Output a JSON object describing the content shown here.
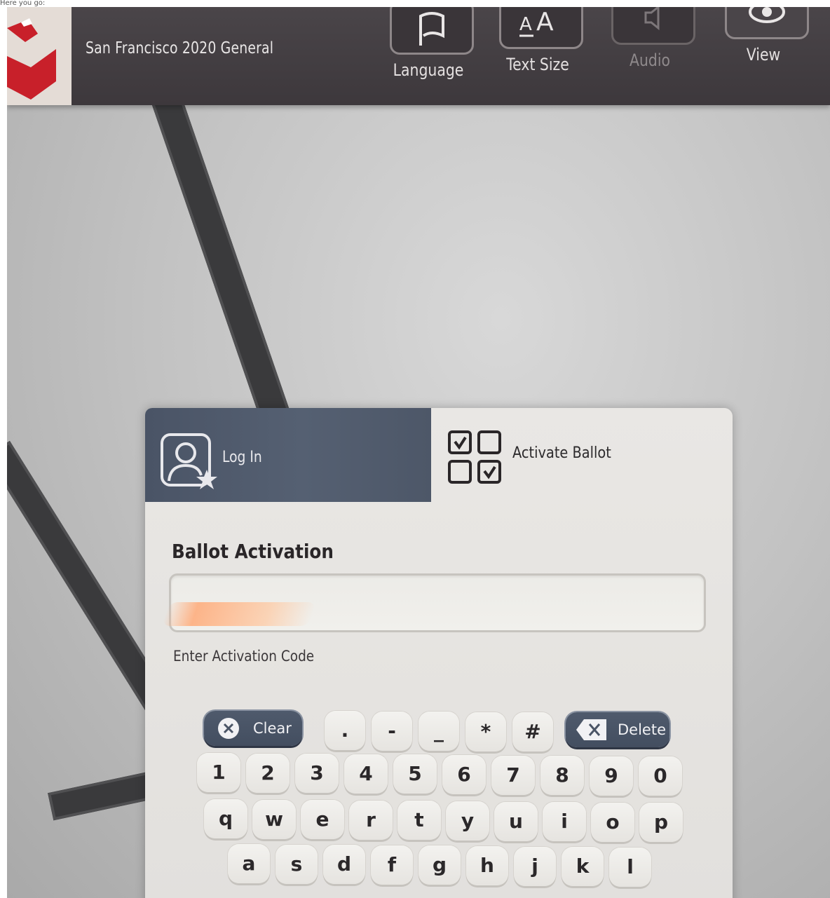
{
  "caption": "Here you go:",
  "header": {
    "election_title": "San Francisco 2020 General",
    "tools": [
      {
        "label": "Language",
        "icon": "flag-icon"
      },
      {
        "label": "Text Size",
        "icon": "text-size-icon"
      },
      {
        "label": "Audio",
        "icon": "audio-icon",
        "state": "disabled"
      },
      {
        "label": "View",
        "icon": "eye-icon"
      }
    ]
  },
  "tabs": {
    "login": {
      "label": "Log In",
      "icon": "user-star-icon"
    },
    "activate": {
      "label": "Activate Ballot",
      "icon": "checkbox-grid-icon",
      "active": true
    }
  },
  "form": {
    "heading": "Ballot Activation",
    "input_value": "",
    "hint": "Enter Activation Code"
  },
  "keyboard": {
    "clear_label": "Clear",
    "delete_label": "Delete",
    "symbols": [
      ".",
      "-",
      "_",
      "*",
      "#"
    ],
    "digits": [
      "1",
      "2",
      "3",
      "4",
      "5",
      "6",
      "7",
      "8",
      "9",
      "0"
    ],
    "row1": [
      "q",
      "w",
      "e",
      "r",
      "t",
      "y",
      "u",
      "i",
      "o",
      "p"
    ],
    "row2": [
      "a",
      "s",
      "d",
      "f",
      "g",
      "h",
      "j",
      "k",
      "l"
    ]
  },
  "colors": {
    "header_bg": "#3d383c",
    "tab_active_bg": "#556072",
    "panel_bg": "#e5e3e0",
    "action_key_bg": "#4a5466",
    "logo_red": "#c8202a"
  }
}
